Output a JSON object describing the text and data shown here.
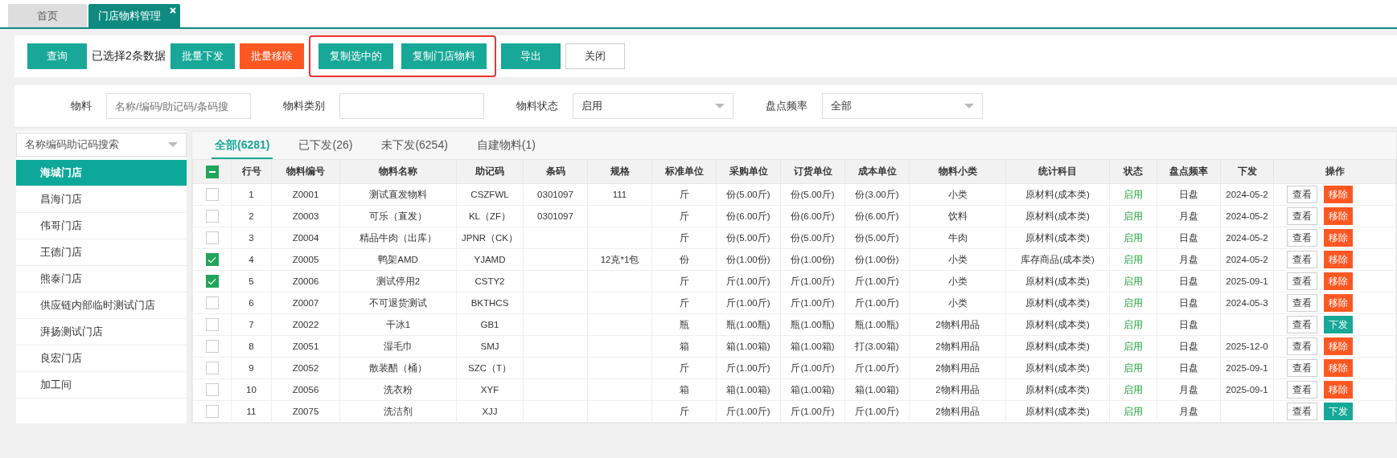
{
  "tabs": [
    {
      "label": "首页",
      "selected": false,
      "closable": false
    },
    {
      "label": "门店物料管理",
      "selected": true,
      "closable": true
    }
  ],
  "toolbar": {
    "query": "查询",
    "selection_info": "已选择2条数据",
    "buttons": [
      {
        "label": "批量下发",
        "kind": "primary",
        "highlighted": false
      },
      {
        "label": "批量移除",
        "kind": "danger",
        "highlighted": false
      },
      {
        "label": "复制选中的",
        "kind": "primary",
        "highlighted": true
      },
      {
        "label": "复制门店物料",
        "kind": "primary",
        "highlighted": true
      },
      {
        "label": "导出",
        "kind": "primary",
        "highlighted": false
      },
      {
        "label": "关闭",
        "kind": "plain",
        "highlighted": false
      }
    ]
  },
  "filters": [
    {
      "label": "物料",
      "kind": "input",
      "placeholder": "名称/编码/助记码/条码搜"
    },
    {
      "label": "物料类别",
      "kind": "input"
    },
    {
      "label": "物料状态",
      "kind": "select",
      "value": "启用"
    },
    {
      "label": "盘点频率",
      "kind": "select",
      "value": "全部"
    }
  ],
  "sidebar": {
    "search": {
      "placeholder": "名称编码助记码搜索"
    },
    "items": [
      {
        "label": "海城门店",
        "selected": true
      },
      {
        "label": "昌海门店",
        "selected": false
      },
      {
        "label": "伟哥门店",
        "selected": false
      },
      {
        "label": "王德门店",
        "selected": false
      },
      {
        "label": "熊泰门店",
        "selected": false
      },
      {
        "label": "供应链内部临时测试门店",
        "selected": false
      },
      {
        "label": "湃扬测试门店",
        "selected": false
      },
      {
        "label": "良宏门店",
        "selected": false
      },
      {
        "label": "加工间",
        "selected": false
      }
    ]
  },
  "view_tabs": [
    {
      "label": "全部(6281)",
      "selected": true
    },
    {
      "label": "已下发(26)",
      "selected": false
    },
    {
      "label": "未下发(6254)",
      "selected": false
    },
    {
      "label": "自建物料(1)",
      "selected": false
    }
  ],
  "table": {
    "header_checkbox": {
      "indeterminate": true
    },
    "columns": [
      "行号",
      "物料编号",
      "物料名称",
      "助记码",
      "条码",
      "规格",
      "标准单位",
      "采购单位",
      "订货单位",
      "成本单位",
      "物料小类",
      "统计科目",
      "状态",
      "盘点频率",
      "下发",
      "操作"
    ],
    "rows": [
      {
        "checked": false,
        "cells": [
          "1",
          "Z0001",
          "测试直发物料",
          "CSZFWL",
          "0301097",
          "111",
          "斤",
          "份(5.00斤)",
          "份(5.00斤)",
          "份(3.00斤)",
          "小类",
          "原材料(成本类)",
          "启用",
          "日盘",
          "2024-05-2"
        ],
        "actions": [
          {
            "label": "查看",
            "kind": "view"
          },
          {
            "label": "移除",
            "kind": "remove"
          }
        ]
      },
      {
        "checked": false,
        "cells": [
          "2",
          "Z0003",
          "可乐（直发）",
          "KL（ZF）",
          "0301097",
          "",
          "斤",
          "份(6.00斤)",
          "份(6.00斤)",
          "份(6.00斤)",
          "饮料",
          "原材料(成本类)",
          "启用",
          "月盘",
          "2024-05-2"
        ],
        "actions": [
          {
            "label": "查看",
            "kind": "view"
          },
          {
            "label": "移除",
            "kind": "remove"
          }
        ]
      },
      {
        "checked": false,
        "cells": [
          "3",
          "Z0004",
          "精品牛肉（出库）",
          "JPNR（CK）",
          "",
          "",
          "斤",
          "份(5.00斤)",
          "份(5.00斤)",
          "份(5.00斤)",
          "牛肉",
          "原材料(成本类)",
          "启用",
          "日盘",
          "2024-05-2"
        ],
        "actions": [
          {
            "label": "查看",
            "kind": "view"
          },
          {
            "label": "移除",
            "kind": "remove"
          }
        ]
      },
      {
        "checked": true,
        "cells": [
          "4",
          "Z0005",
          "鸭架AMD",
          "YJAMD",
          "",
          "12克*1包",
          "份",
          "份(1.00份)",
          "份(1.00份)",
          "份(1.00份)",
          "小类",
          "库存商品(成本类)",
          "启用",
          "月盘",
          "2024-05-2"
        ],
        "actions": [
          {
            "label": "查看",
            "kind": "view"
          },
          {
            "label": "移除",
            "kind": "remove"
          }
        ]
      },
      {
        "checked": true,
        "cells": [
          "5",
          "Z0006",
          "测试停用2",
          "CSTY2",
          "",
          "",
          "斤",
          "斤(1.00斤)",
          "斤(1.00斤)",
          "斤(1.00斤)",
          "小类",
          "原材料(成本类)",
          "启用",
          "日盘",
          "2025-09-1"
        ],
        "actions": [
          {
            "label": "查看",
            "kind": "view"
          },
          {
            "label": "移除",
            "kind": "remove"
          }
        ]
      },
      {
        "checked": false,
        "cells": [
          "6",
          "Z0007",
          "不可退货测试",
          "BKTHCS",
          "",
          "",
          "斤",
          "斤(1.00斤)",
          "斤(1.00斤)",
          "斤(1.00斤)",
          "小类",
          "原材料(成本类)",
          "启用",
          "日盘",
          "2024-05-3"
        ],
        "actions": [
          {
            "label": "查看",
            "kind": "view"
          },
          {
            "label": "移除",
            "kind": "remove"
          }
        ]
      },
      {
        "checked": false,
        "cells": [
          "7",
          "Z0022",
          "干冰1",
          "GB1",
          "",
          "",
          "瓶",
          "瓶(1.00瓶)",
          "瓶(1.00瓶)",
          "瓶(1.00瓶)",
          "2物料用品",
          "原材料(成本类)",
          "启用",
          "日盘",
          ""
        ],
        "actions": [
          {
            "label": "查看",
            "kind": "view"
          },
          {
            "label": "下发",
            "kind": "issue"
          }
        ]
      },
      {
        "checked": false,
        "cells": [
          "8",
          "Z0051",
          "湿毛巾",
          "SMJ",
          "",
          "",
          "箱",
          "箱(1.00箱)",
          "箱(1.00箱)",
          "打(3.00箱)",
          "2物料用品",
          "原材料(成本类)",
          "启用",
          "日盘",
          "2025-12-0"
        ],
        "actions": [
          {
            "label": "查看",
            "kind": "view"
          },
          {
            "label": "移除",
            "kind": "remove"
          }
        ]
      },
      {
        "checked": false,
        "cells": [
          "9",
          "Z0052",
          "散装醋（桶）",
          "SZC（T）",
          "",
          "",
          "斤",
          "斤(1.00斤)",
          "斤(1.00斤)",
          "斤(1.00斤)",
          "2物料用品",
          "原材料(成本类)",
          "启用",
          "日盘",
          "2025-09-1"
        ],
        "actions": [
          {
            "label": "查看",
            "kind": "view"
          },
          {
            "label": "移除",
            "kind": "remove"
          }
        ]
      },
      {
        "checked": false,
        "cells": [
          "10",
          "Z0056",
          "洗衣粉",
          "XYF",
          "",
          "",
          "箱",
          "箱(1.00箱)",
          "箱(1.00箱)",
          "箱(1.00箱)",
          "2物料用品",
          "原材料(成本类)",
          "启用",
          "月盘",
          "2025-09-1"
        ],
        "actions": [
          {
            "label": "查看",
            "kind": "view"
          },
          {
            "label": "移除",
            "kind": "remove"
          }
        ]
      },
      {
        "checked": false,
        "cells": [
          "11",
          "Z0075",
          "洗洁剂",
          "XJJ",
          "",
          "",
          "斤",
          "斤(1.00斤)",
          "斤(1.00斤)",
          "斤(1.00斤)",
          "2物料用品",
          "原材料(成本类)",
          "启用",
          "月盘",
          ""
        ],
        "actions": [
          {
            "label": "查看",
            "kind": "view"
          },
          {
            "label": "下发",
            "kind": "issue"
          }
        ]
      }
    ]
  }
}
